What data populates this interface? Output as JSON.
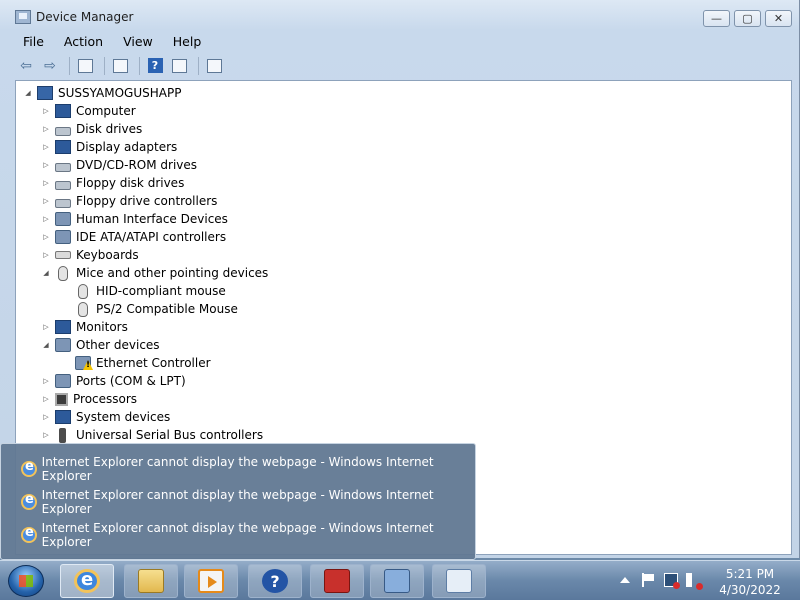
{
  "window": {
    "title": "Device Manager",
    "buttons": {
      "minimize": "—",
      "maximize": "▢",
      "close": "✕"
    }
  },
  "menu": [
    "File",
    "Action",
    "View",
    "Help"
  ],
  "toolbar": {
    "back": "⇦",
    "forward": "⇨",
    "help": "?"
  },
  "tree": {
    "root": "SUSSYAMOGUSHAPP",
    "items": [
      {
        "label": "Computer",
        "icon": "computer-icon",
        "expander": "▷"
      },
      {
        "label": "Disk drives",
        "icon": "disk-drive-icon",
        "expander": "▷"
      },
      {
        "label": "Display adapters",
        "icon": "display-adapter-icon",
        "expander": "▷"
      },
      {
        "label": "DVD/CD-ROM drives",
        "icon": "dvd-drive-icon",
        "expander": "▷"
      },
      {
        "label": "Floppy disk drives",
        "icon": "floppy-drive-icon",
        "expander": "▷"
      },
      {
        "label": "Floppy drive controllers",
        "icon": "floppy-controller-icon",
        "expander": "▷"
      },
      {
        "label": "Human Interface Devices",
        "icon": "hid-icon",
        "expander": "▷"
      },
      {
        "label": "IDE ATA/ATAPI controllers",
        "icon": "ide-controller-icon",
        "expander": "▷"
      },
      {
        "label": "Keyboards",
        "icon": "keyboard-icon",
        "expander": "▷"
      },
      {
        "label": "Mice and other pointing devices",
        "icon": "mouse-icon",
        "expander": "◢"
      },
      {
        "label": "HID-compliant mouse",
        "icon": "mouse-icon",
        "child": true
      },
      {
        "label": "PS/2 Compatible Mouse",
        "icon": "mouse-icon",
        "child": true
      },
      {
        "label": "Monitors",
        "icon": "monitor-icon",
        "expander": "▷"
      },
      {
        "label": "Other devices",
        "icon": "other-devices-icon",
        "expander": "◢"
      },
      {
        "label": "Ethernet Controller",
        "icon": "warning-device-icon",
        "child": true
      },
      {
        "label": "Ports (COM & LPT)",
        "icon": "port-icon",
        "expander": "▷"
      },
      {
        "label": "Processors",
        "icon": "processor-icon",
        "expander": "▷"
      },
      {
        "label": "System devices",
        "icon": "system-device-icon",
        "expander": "▷"
      },
      {
        "label": "Universal Serial Bus controllers",
        "icon": "usb-icon",
        "expander": "▷"
      }
    ]
  },
  "popup": {
    "items": [
      "Internet Explorer cannot display the webpage - Windows Internet Explorer",
      "Internet Explorer cannot display the webpage - Windows Internet Explorer",
      "Internet Explorer cannot display the webpage - Windows Internet Explorer"
    ]
  },
  "taskbar": {
    "time": "5:21 PM",
    "date": "4/30/2022",
    "help_glyph": "?"
  }
}
